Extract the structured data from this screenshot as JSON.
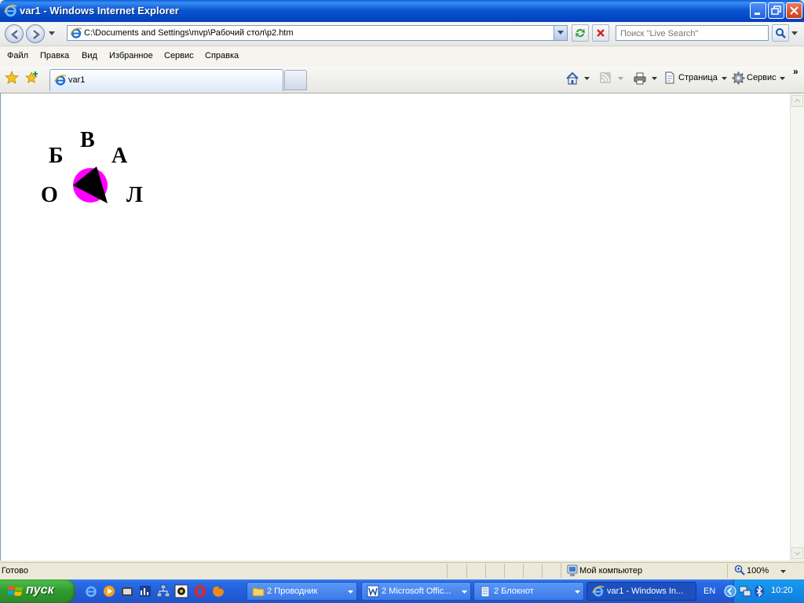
{
  "window": {
    "title": "var1 - Windows Internet Explorer",
    "colors": {
      "titlebar": "#0a5fd8",
      "close": "#c8401e"
    }
  },
  "address": {
    "url": "C:\\Documents and Settings\\mvp\\Рабочий стол\\p2.htm"
  },
  "search": {
    "placeholder": "Поиск \"Live Search\""
  },
  "menu": {
    "items": [
      "Файл",
      "Правка",
      "Вид",
      "Избранное",
      "Сервис",
      "Справка"
    ]
  },
  "tabs": {
    "active_label": "var1"
  },
  "commandbar": {
    "page_label": "Страница",
    "tools_label": "Сервис",
    "more": "»"
  },
  "content": {
    "letters": [
      "В",
      "Б",
      "А",
      "О",
      "Л"
    ],
    "colors": {
      "circle": "#ff00ff",
      "triangle": "#000000"
    }
  },
  "status": {
    "text": "Готово",
    "zone": "Мой компьютер",
    "zoom": "100%"
  },
  "taskbar": {
    "start_label": "пуск",
    "tasks": [
      {
        "label": "2 Проводник",
        "icon": "folder-icon"
      },
      {
        "label": "2 Microsoft Offic...",
        "icon": "word-icon"
      },
      {
        "label": "2 Блокнот",
        "icon": "notepad-icon"
      },
      {
        "label": "var1 - Windows In...",
        "icon": "ie-icon"
      }
    ],
    "language": "EN",
    "clock": "10:20"
  }
}
